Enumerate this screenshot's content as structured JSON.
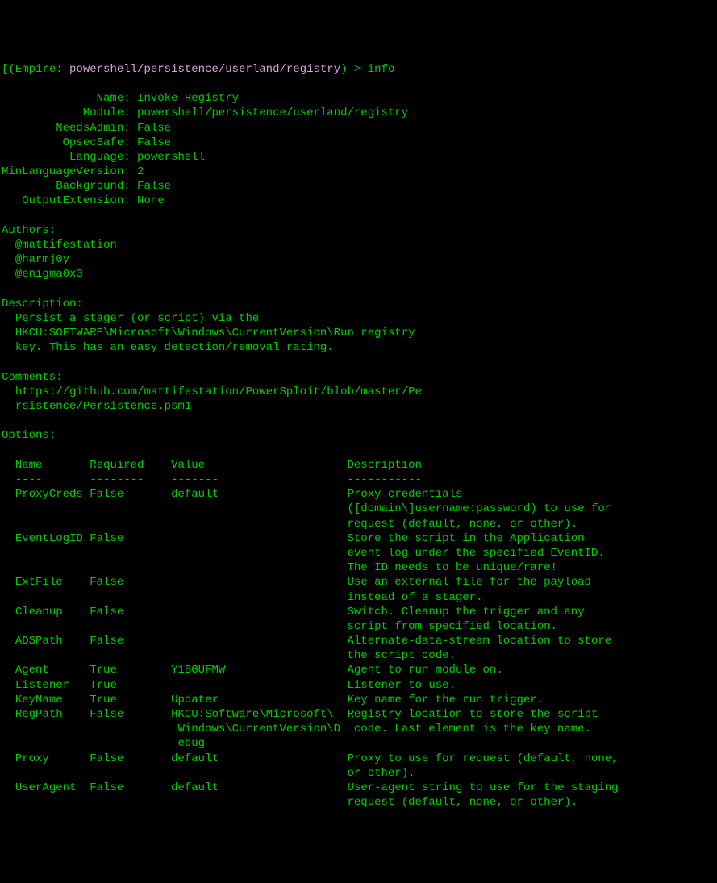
{
  "prompt": {
    "bracket_open": "[(",
    "empire": "Empire",
    "colon": ": ",
    "path": "powershell/persistence/userland/registry",
    "bracket_close": ")",
    "arrow": " > ",
    "command": "info"
  },
  "meta": {
    "name_label": "Name:",
    "name_value": "Invoke-Registry",
    "module_label": "Module:",
    "module_value": "powershell/persistence/userland/registry",
    "needsadmin_label": "NeedsAdmin:",
    "needsadmin_value": "False",
    "opsecsafe_label": "OpsecSafe:",
    "opsecsafe_value": "False",
    "language_label": "Language:",
    "language_value": "powershell",
    "minlang_label": "MinLanguageVersion:",
    "minlang_value": "2",
    "background_label": "Background:",
    "background_value": "False",
    "outputext_label": "OutputExtension:",
    "outputext_value": "None"
  },
  "authors": {
    "label": "Authors:",
    "a1": "@mattifestation",
    "a2": "@harmj0y",
    "a3": "@enigma0x3"
  },
  "description": {
    "label": "Description:",
    "l1": "Persist a stager (or script) via the",
    "l2": "HKCU:SOFTWARE\\Microsoft\\Windows\\CurrentVersion\\Run registry",
    "l3": "key. This has an easy detection/removal rating."
  },
  "comments": {
    "label": "Comments:",
    "l1": "https://github.com/mattifestation/PowerSploit/blob/master/Pe",
    "l2": "rsistence/Persistence.psm1"
  },
  "options": {
    "label": "Options:",
    "header": {
      "name": "Name",
      "required": "Required",
      "value": "Value",
      "description": "Description",
      "d1": "----",
      "d2": "--------",
      "d3": "-------",
      "d4": "-----------"
    },
    "rows": {
      "r0": {
        "name": "ProxyCreds",
        "required": "False",
        "value": "default",
        "desc1": "Proxy credentials",
        "desc2": "([domain\\]username:password) to use for",
        "desc3": "request (default, none, or other)."
      },
      "r1": {
        "name": "EventLogID",
        "required": "False",
        "value": "",
        "desc1": "Store the script in the Application",
        "desc2": "event log under the specified EventID.",
        "desc3": "The ID needs to be unique/rare!"
      },
      "r2": {
        "name": "ExtFile",
        "required": "False",
        "value": "",
        "desc1": "Use an external file for the payload",
        "desc2": "instead of a stager."
      },
      "r3": {
        "name": "Cleanup",
        "required": "False",
        "value": "",
        "desc1": "Switch. Cleanup the trigger and any",
        "desc2": "script from specified location."
      },
      "r4": {
        "name": "ADSPath",
        "required": "False",
        "value": "",
        "desc1": "Alternate-data-stream location to store",
        "desc2": "the script code."
      },
      "r5": {
        "name": "Agent",
        "required": "True",
        "value": "Y1BGUFMW",
        "desc1": "Agent to run module on."
      },
      "r6": {
        "name": "Listener",
        "required": "True",
        "value": "",
        "desc1": "Listener to use."
      },
      "r7": {
        "name": "KeyName",
        "required": "True",
        "value": "Updater",
        "desc1": "Key name for the run trigger."
      },
      "r8": {
        "name": "RegPath",
        "required": "False",
        "value1": "HKCU:Software\\Microsoft\\",
        "value2": "Windows\\CurrentVersion\\D",
        "value3": "ebug",
        "desc1": "Registry location to store the script",
        "desc2": "code. Last element is the key name."
      },
      "r9": {
        "name": "Proxy",
        "required": "False",
        "value": "default",
        "desc1": "Proxy to use for request (default, none,",
        "desc2": "or other)."
      },
      "r10": {
        "name": "UserAgent",
        "required": "False",
        "value": "default",
        "desc1": "User-agent string to use for the staging",
        "desc2": "request (default, none, or other)."
      }
    }
  }
}
